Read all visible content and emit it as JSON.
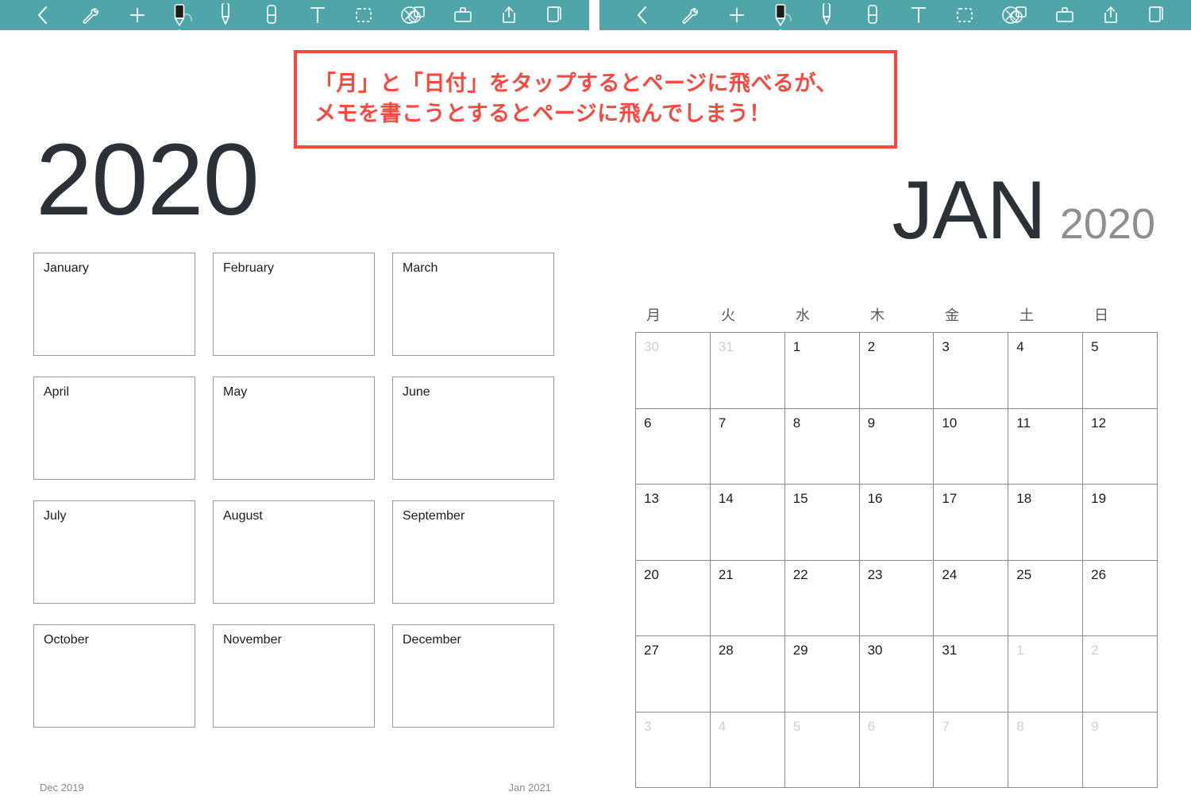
{
  "toolbar": {
    "background_color": "#4fa5a7",
    "left_tools": [
      {
        "name": "back-icon",
        "label": "Back"
      },
      {
        "name": "wrench-icon",
        "label": "Tools"
      },
      {
        "name": "plus-icon",
        "label": "Add Page"
      },
      {
        "name": "undo-icon",
        "label": "Undo"
      }
    ],
    "center_tools": [
      {
        "name": "pen-icon",
        "label": "Pen",
        "active": true
      },
      {
        "name": "highlighter-icon",
        "label": "Highlighter",
        "active": false
      },
      {
        "name": "eraser-icon",
        "label": "Eraser",
        "active": false
      },
      {
        "name": "text-tool-icon",
        "label": "Text",
        "active": false
      },
      {
        "name": "selection-marquee-icon",
        "label": "Select",
        "active": false
      },
      {
        "name": "circle-x-icon",
        "label": "Clear",
        "active": false
      }
    ],
    "right_tools": [
      {
        "name": "shapes-icon",
        "label": "Shapes"
      },
      {
        "name": "image-insert-icon",
        "label": "Insert Image"
      },
      {
        "name": "share-icon",
        "label": "Share"
      },
      {
        "name": "pages-icon",
        "label": "Pages"
      }
    ]
  },
  "annotation": {
    "border_color": "#f7493f",
    "text_color": "#f7493f",
    "lines": [
      "「月」と「日付」をタップするとページに飛べるが、",
      "メモを書こうとするとページに飛んでしまう！"
    ]
  },
  "year_page": {
    "title": "2020",
    "months": [
      "January",
      "February",
      "March",
      "April",
      "May",
      "June",
      "July",
      "August",
      "September",
      "October",
      "November",
      "December"
    ],
    "footer_prev": "Dec 2019",
    "footer_next": "Jan 2021"
  },
  "month_page": {
    "month_abbr": "JAN",
    "year": "2020",
    "weekdays": [
      "月",
      "火",
      "水",
      "木",
      "金",
      "土",
      "日"
    ],
    "weeks": [
      [
        {
          "day": "30",
          "in_month": false
        },
        {
          "day": "31",
          "in_month": false
        },
        {
          "day": "1",
          "in_month": true
        },
        {
          "day": "2",
          "in_month": true
        },
        {
          "day": "3",
          "in_month": true
        },
        {
          "day": "4",
          "in_month": true
        },
        {
          "day": "5",
          "in_month": true
        }
      ],
      [
        {
          "day": "6",
          "in_month": true
        },
        {
          "day": "7",
          "in_month": true
        },
        {
          "day": "8",
          "in_month": true
        },
        {
          "day": "9",
          "in_month": true
        },
        {
          "day": "10",
          "in_month": true
        },
        {
          "day": "11",
          "in_month": true
        },
        {
          "day": "12",
          "in_month": true
        }
      ],
      [
        {
          "day": "13",
          "in_month": true
        },
        {
          "day": "14",
          "in_month": true
        },
        {
          "day": "15",
          "in_month": true
        },
        {
          "day": "16",
          "in_month": true
        },
        {
          "day": "17",
          "in_month": true
        },
        {
          "day": "18",
          "in_month": true
        },
        {
          "day": "19",
          "in_month": true
        }
      ],
      [
        {
          "day": "20",
          "in_month": true
        },
        {
          "day": "21",
          "in_month": true
        },
        {
          "day": "22",
          "in_month": true
        },
        {
          "day": "23",
          "in_month": true
        },
        {
          "day": "24",
          "in_month": true
        },
        {
          "day": "25",
          "in_month": true
        },
        {
          "day": "26",
          "in_month": true
        }
      ],
      [
        {
          "day": "27",
          "in_month": true
        },
        {
          "day": "28",
          "in_month": true
        },
        {
          "day": "29",
          "in_month": true
        },
        {
          "day": "30",
          "in_month": true
        },
        {
          "day": "31",
          "in_month": true
        },
        {
          "day": "1",
          "in_month": false
        },
        {
          "day": "2",
          "in_month": false
        }
      ],
      [
        {
          "day": "3",
          "in_month": false
        },
        {
          "day": "4",
          "in_month": false
        },
        {
          "day": "5",
          "in_month": false
        },
        {
          "day": "6",
          "in_month": false
        },
        {
          "day": "7",
          "in_month": false
        },
        {
          "day": "8",
          "in_month": false
        },
        {
          "day": "9",
          "in_month": false
        }
      ]
    ]
  }
}
